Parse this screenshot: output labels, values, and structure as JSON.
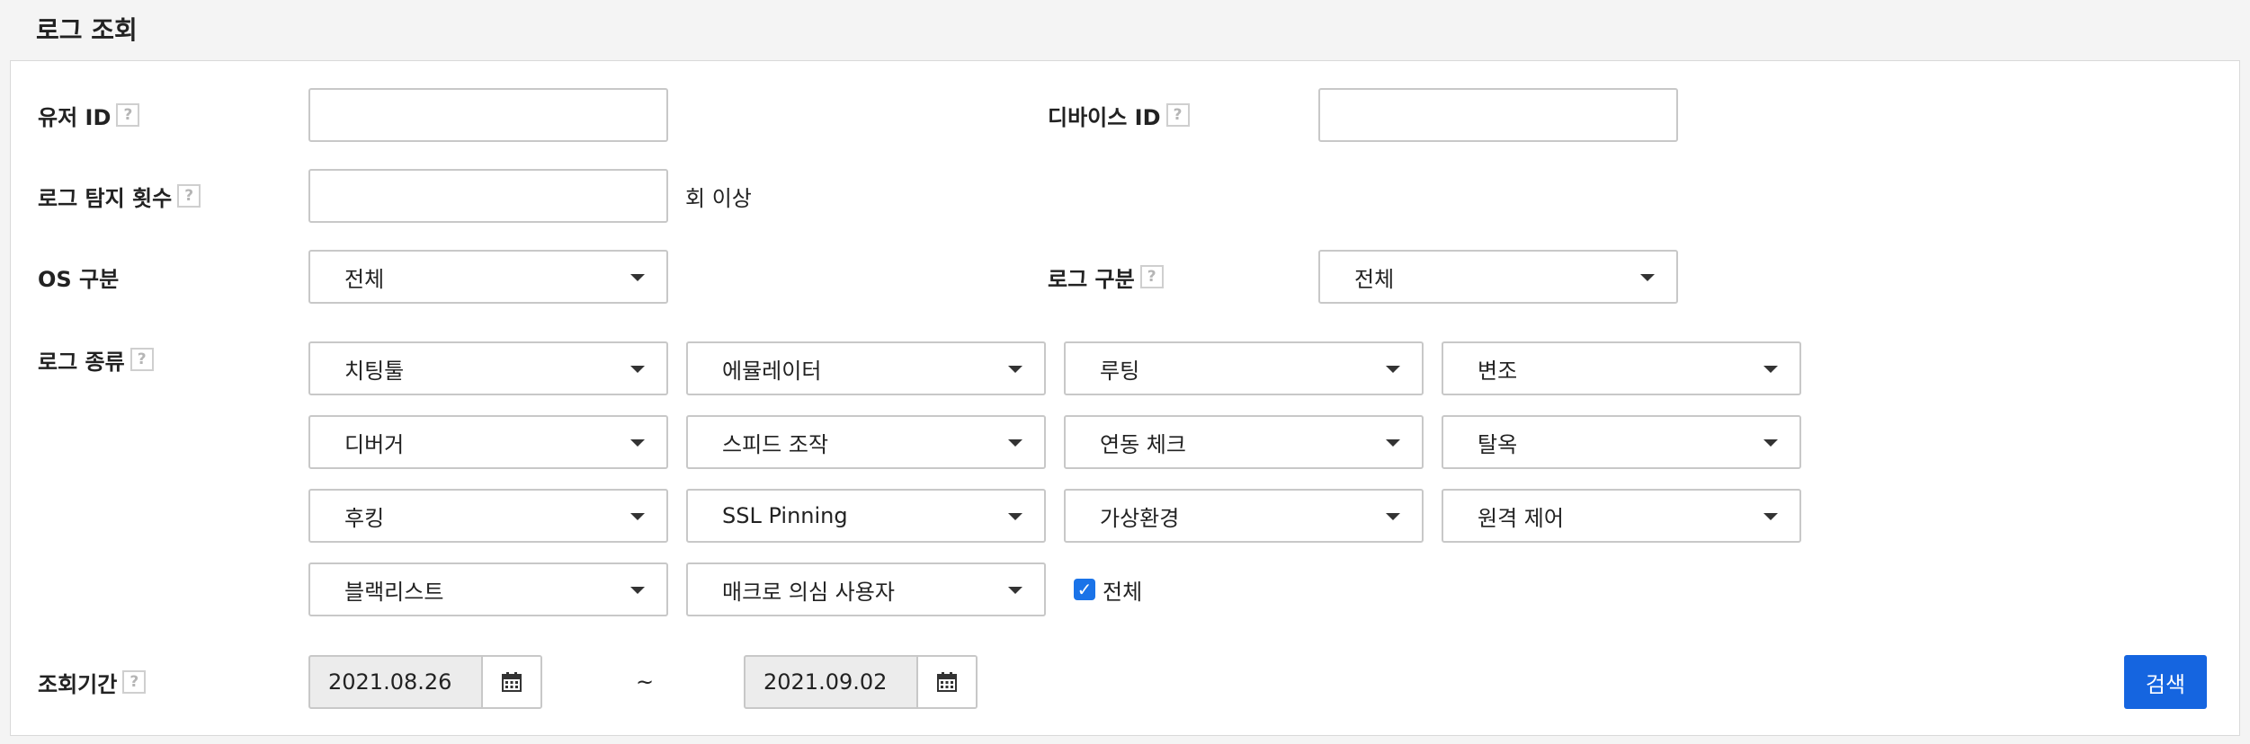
{
  "page": {
    "title": "로그 조회"
  },
  "help_icon": "?",
  "fields": {
    "user_id": {
      "label": "유저 ID",
      "value": ""
    },
    "device_id": {
      "label": "디바이스 ID",
      "value": ""
    },
    "detect_count": {
      "label": "로그 탐지 횟수",
      "value": "",
      "suffix": "회 이상"
    },
    "os": {
      "label": "OS 구분",
      "selected": "전체"
    },
    "log_category": {
      "label": "로그 구분",
      "selected": "전체"
    },
    "log_type": {
      "label": "로그 종류",
      "selects": [
        "치팅툴",
        "에뮬레이터",
        "루팅",
        "변조",
        "디버거",
        "스피드 조작",
        "연동 체크",
        "탈옥",
        "후킹",
        "SSL Pinning",
        "가상환경",
        "원격 제어",
        "블랙리스트",
        "매크로 의심 사용자"
      ],
      "all_checkbox": {
        "label": "전체",
        "checked": true
      }
    },
    "period": {
      "label": "조회기간",
      "start": "2021.08.26",
      "end": "2021.09.02",
      "separator": "~"
    }
  },
  "search_button": "검색",
  "icons": {
    "dropdown": "caret-down-icon",
    "calendar": "calendar-icon",
    "help": "help-icon"
  },
  "colors": {
    "primary": "#1565e0",
    "checkbox": "#1a73e8"
  }
}
